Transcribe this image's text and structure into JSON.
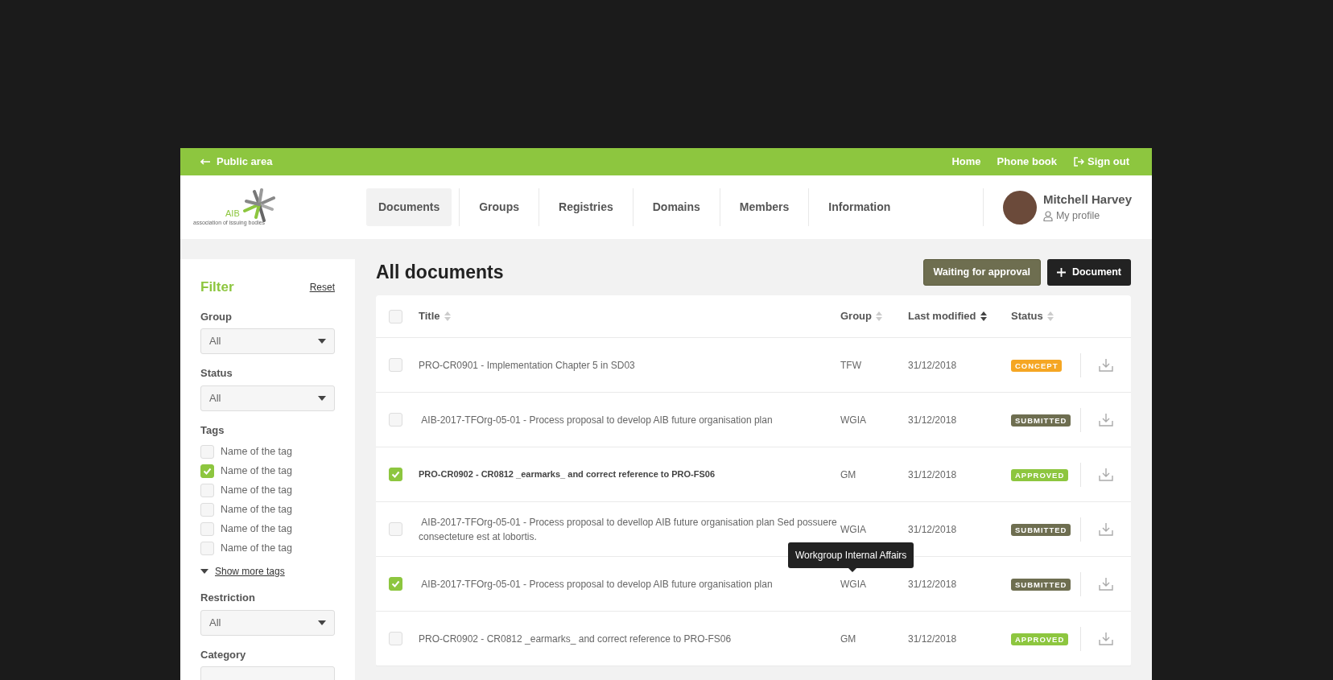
{
  "topbar": {
    "back_link": "Public area",
    "links": [
      {
        "label": "Home",
        "kind": "link"
      },
      {
        "label": "Phone book",
        "kind": "link"
      },
      {
        "label": "Sign out",
        "kind": "signout"
      }
    ]
  },
  "header": {
    "logo": {
      "name": "AIB",
      "tagline": "association of issuing bodies"
    },
    "nav": [
      {
        "label": "Documents",
        "selected": true
      },
      {
        "label": "Groups",
        "selected": false
      },
      {
        "label": "Registries",
        "selected": false
      },
      {
        "label": "Domains",
        "selected": false
      },
      {
        "label": "Members",
        "selected": false
      },
      {
        "label": "Information",
        "selected": false
      }
    ],
    "user": {
      "name": "Mitchell Harvey",
      "profile_link": "My profile"
    }
  },
  "filter": {
    "title": "Filter",
    "reset": "Reset",
    "sections": [
      {
        "kind": "select",
        "label": "Group",
        "value": "All"
      },
      {
        "kind": "select",
        "label": "Status",
        "value": "All"
      },
      {
        "kind": "tags",
        "label": "Tags",
        "more": "Show more tags",
        "tags": [
          {
            "label": "Name of the tag",
            "checked": false
          },
          {
            "label": "Name of the tag",
            "checked": true
          },
          {
            "label": "Name of the tag",
            "checked": false
          },
          {
            "label": "Name of the tag",
            "checked": false
          },
          {
            "label": "Name of the tag",
            "checked": false
          },
          {
            "label": "Name of the tag",
            "checked": false
          }
        ]
      },
      {
        "kind": "select",
        "label": "Restriction",
        "value": "All"
      },
      {
        "kind": "select",
        "label": "Category"
      }
    ]
  },
  "main": {
    "title": "All documents",
    "buttons": [
      {
        "label": "Waiting for approval",
        "kind": "secondary"
      },
      {
        "label": "Document",
        "kind": "add"
      }
    ],
    "table": {
      "all_checked": false,
      "columns": [
        {
          "label": "Title",
          "sorted": false
        },
        {
          "label": "Group",
          "sorted": false
        },
        {
          "label": "Last modified",
          "sorted": true
        },
        {
          "label": "Status",
          "sorted": false
        }
      ],
      "rows": [
        {
          "checked": false,
          "unread": false,
          "title": "PRO-CR0901 - Implementation Chapter 5 in SD03",
          "group": "TFW",
          "modified": "31/12/2018",
          "status": "CONCEPT",
          "color": "#f5a623"
        },
        {
          "checked": false,
          "unread": false,
          "title": " AIB-2017-TFOrg-05-01 - Process proposal to develop AIB future organisation plan",
          "group": "WGIA",
          "modified": "31/12/2018",
          "status": "SUBMITTED",
          "color": "#6e6e50"
        },
        {
          "checked": true,
          "unread": true,
          "title": "PRO-CR0902 - CR0812 _earmarks_ and correct reference to PRO-FS06",
          "group": "GM",
          "modified": "31/12/2018",
          "status": "APPROVED",
          "color": "#8dc63f"
        },
        {
          "checked": false,
          "unread": false,
          "title": " AIB-2017-TFOrg-05-01 - Process proposal to devellop AIB future organisation plan Sed possuere consecteture est at lobortis.",
          "group": "WGIA",
          "modified": "31/12/2018",
          "status": "SUBMITTED",
          "color": "#6e6e50"
        },
        {
          "checked": true,
          "unread": false,
          "title": " AIB-2017-TFOrg-05-01 - Process proposal to develop AIB future organisation plan",
          "group": "WGIA",
          "tooltip": "Workgroup Internal Affairs",
          "modified": "31/12/2018",
          "status": "SUBMITTED",
          "color": "#6e6e50"
        },
        {
          "checked": false,
          "unread": false,
          "title": "PRO-CR0902 - CR0812 _earmarks_ and correct reference to PRO-FS06",
          "group": "GM",
          "modified": "31/12/2018",
          "status": "APPROVED",
          "color": "#8dc63f"
        }
      ]
    }
  }
}
